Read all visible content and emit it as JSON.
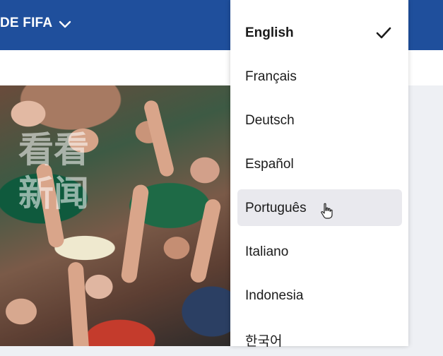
{
  "header": {
    "label": "DE FIFA",
    "chevron_icon": "chevron-down-icon"
  },
  "hero": {
    "watermark": "看看新闻"
  },
  "language_menu": {
    "items": [
      {
        "label": "English",
        "selected": true
      },
      {
        "label": "Français"
      },
      {
        "label": "Deutsch"
      },
      {
        "label": "Español"
      },
      {
        "label": "Português",
        "hovered": true
      },
      {
        "label": "Italiano"
      },
      {
        "label": "Indonesia"
      },
      {
        "label": "한국어"
      }
    ]
  },
  "colors": {
    "header_bg": "#1f4f9c",
    "menu_hover": "#e9e9ee",
    "text": "#1b1b1b"
  }
}
